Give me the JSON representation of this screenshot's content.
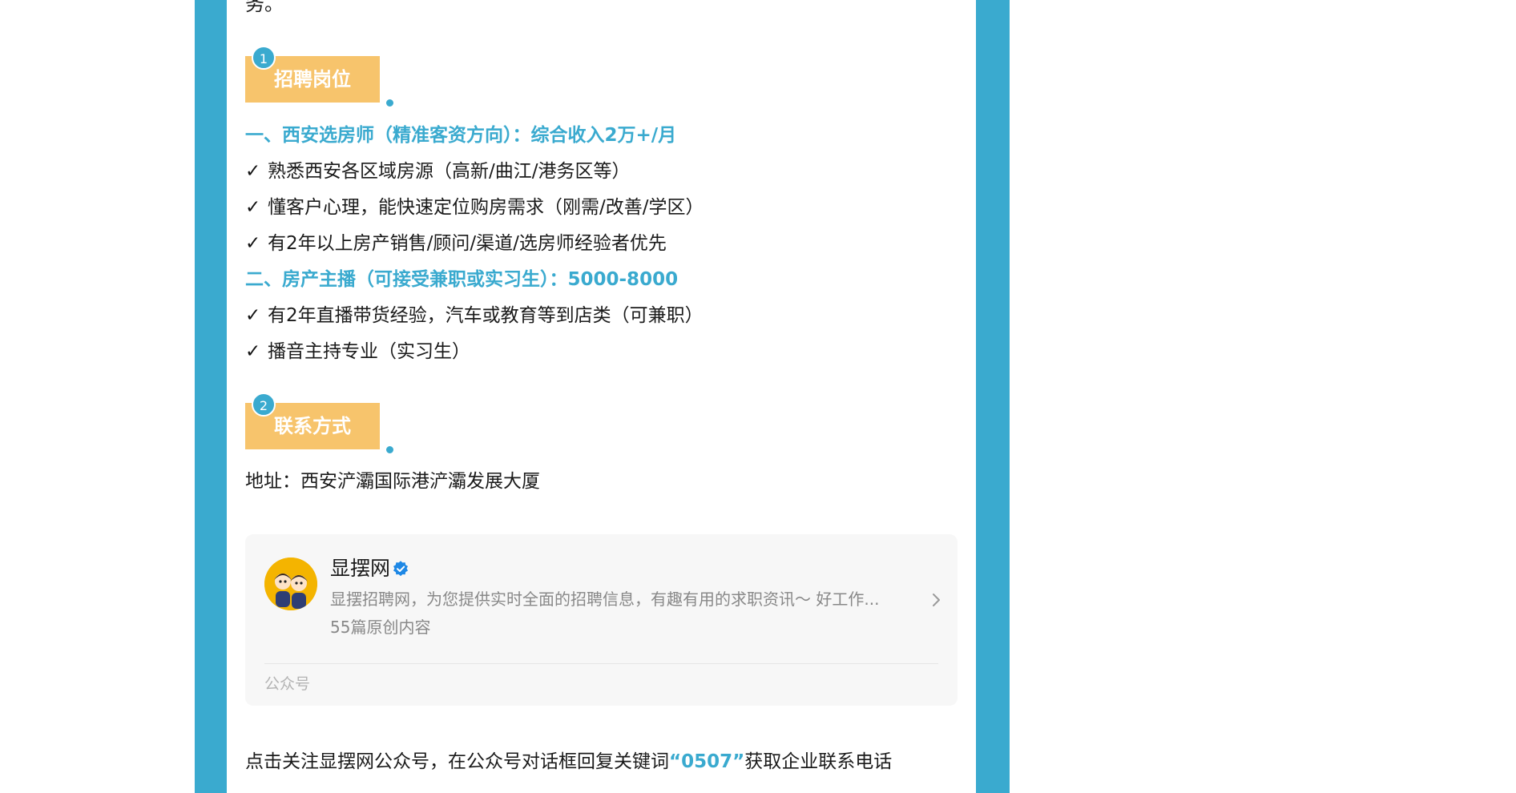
{
  "article": {
    "cut_line": "务。",
    "section1": {
      "number": "1",
      "title": "招聘岗位"
    },
    "job1": {
      "heading": "一、西安选房师（精准客资方向）：综合收入2万+/月",
      "items": [
        "熟悉西安各区域房源（高新/曲江/港务区等）",
        "懂客户心理，能快速定位购房需求（刚需/改善/学区）",
        "有2年以上房产销售/顾问/渠道/选房师经验者优先"
      ]
    },
    "job2": {
      "heading": "二、房产主播（可接受兼职或实习生）：5000-8000",
      "items": [
        "有2年直播带货经验，汽车或教育等到店类（可兼职）",
        "播音主持专业（实习生）"
      ]
    },
    "check_mark": "✓",
    "section2": {
      "number": "2",
      "title": "联系方式"
    },
    "address": "地址：西安浐灞国际港浐灞发展大厦",
    "cta": {
      "prefix": "点击关注显摆网公众号，在公众号对话框回复关键词",
      "keyword": "“0507”",
      "suffix": "获取企业联系电话"
    }
  },
  "account_card": {
    "name": "显摆网",
    "description": "显摆招聘网，为您提供实时全面的招聘信息，有趣有用的求职资讯～ 好工作...",
    "original_count": "55篇原创内容",
    "label": "公众号",
    "icons": {
      "verified": "verified-badge-icon",
      "chevron": "chevron-right-icon",
      "avatar": "cartoon-couple-avatar"
    }
  },
  "colors": {
    "frame": "#3aaacf",
    "accent": "#3aaacf",
    "tag": "#f7c46c",
    "card_bg": "#f7f7f7",
    "muted_text": "#888888"
  }
}
